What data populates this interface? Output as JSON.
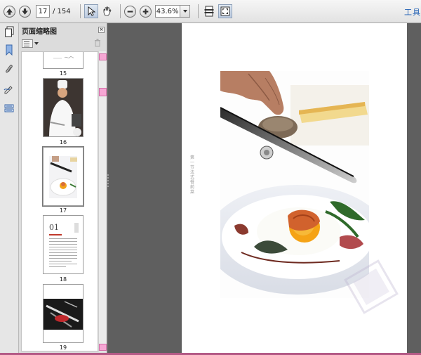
{
  "toolbar": {
    "current_page": "17",
    "total_pages": "/ 154",
    "zoom": "43.6%",
    "tools_label": "工具",
    "icons": [
      "prev-page-icon",
      "next-page-icon",
      "select-arrow-icon",
      "hand-icon",
      "zoom-out-icon",
      "zoom-in-icon",
      "fit-page-icon",
      "full-screen-icon"
    ]
  },
  "panel": {
    "title": "页面缩略图",
    "close_label": "×",
    "thumbnails": [
      {
        "label": "15"
      },
      {
        "label": "16"
      },
      {
        "label": "17"
      },
      {
        "label": "18"
      },
      {
        "label": "19"
      }
    ]
  },
  "document": {
    "vertical_text": "第一节 法式餐前菜",
    "selected_page": "17"
  },
  "colors": {
    "accent_pink": "#f6a6d4",
    "tools_blue": "#1f5fb4",
    "doc_background": "#5f5f5f"
  }
}
